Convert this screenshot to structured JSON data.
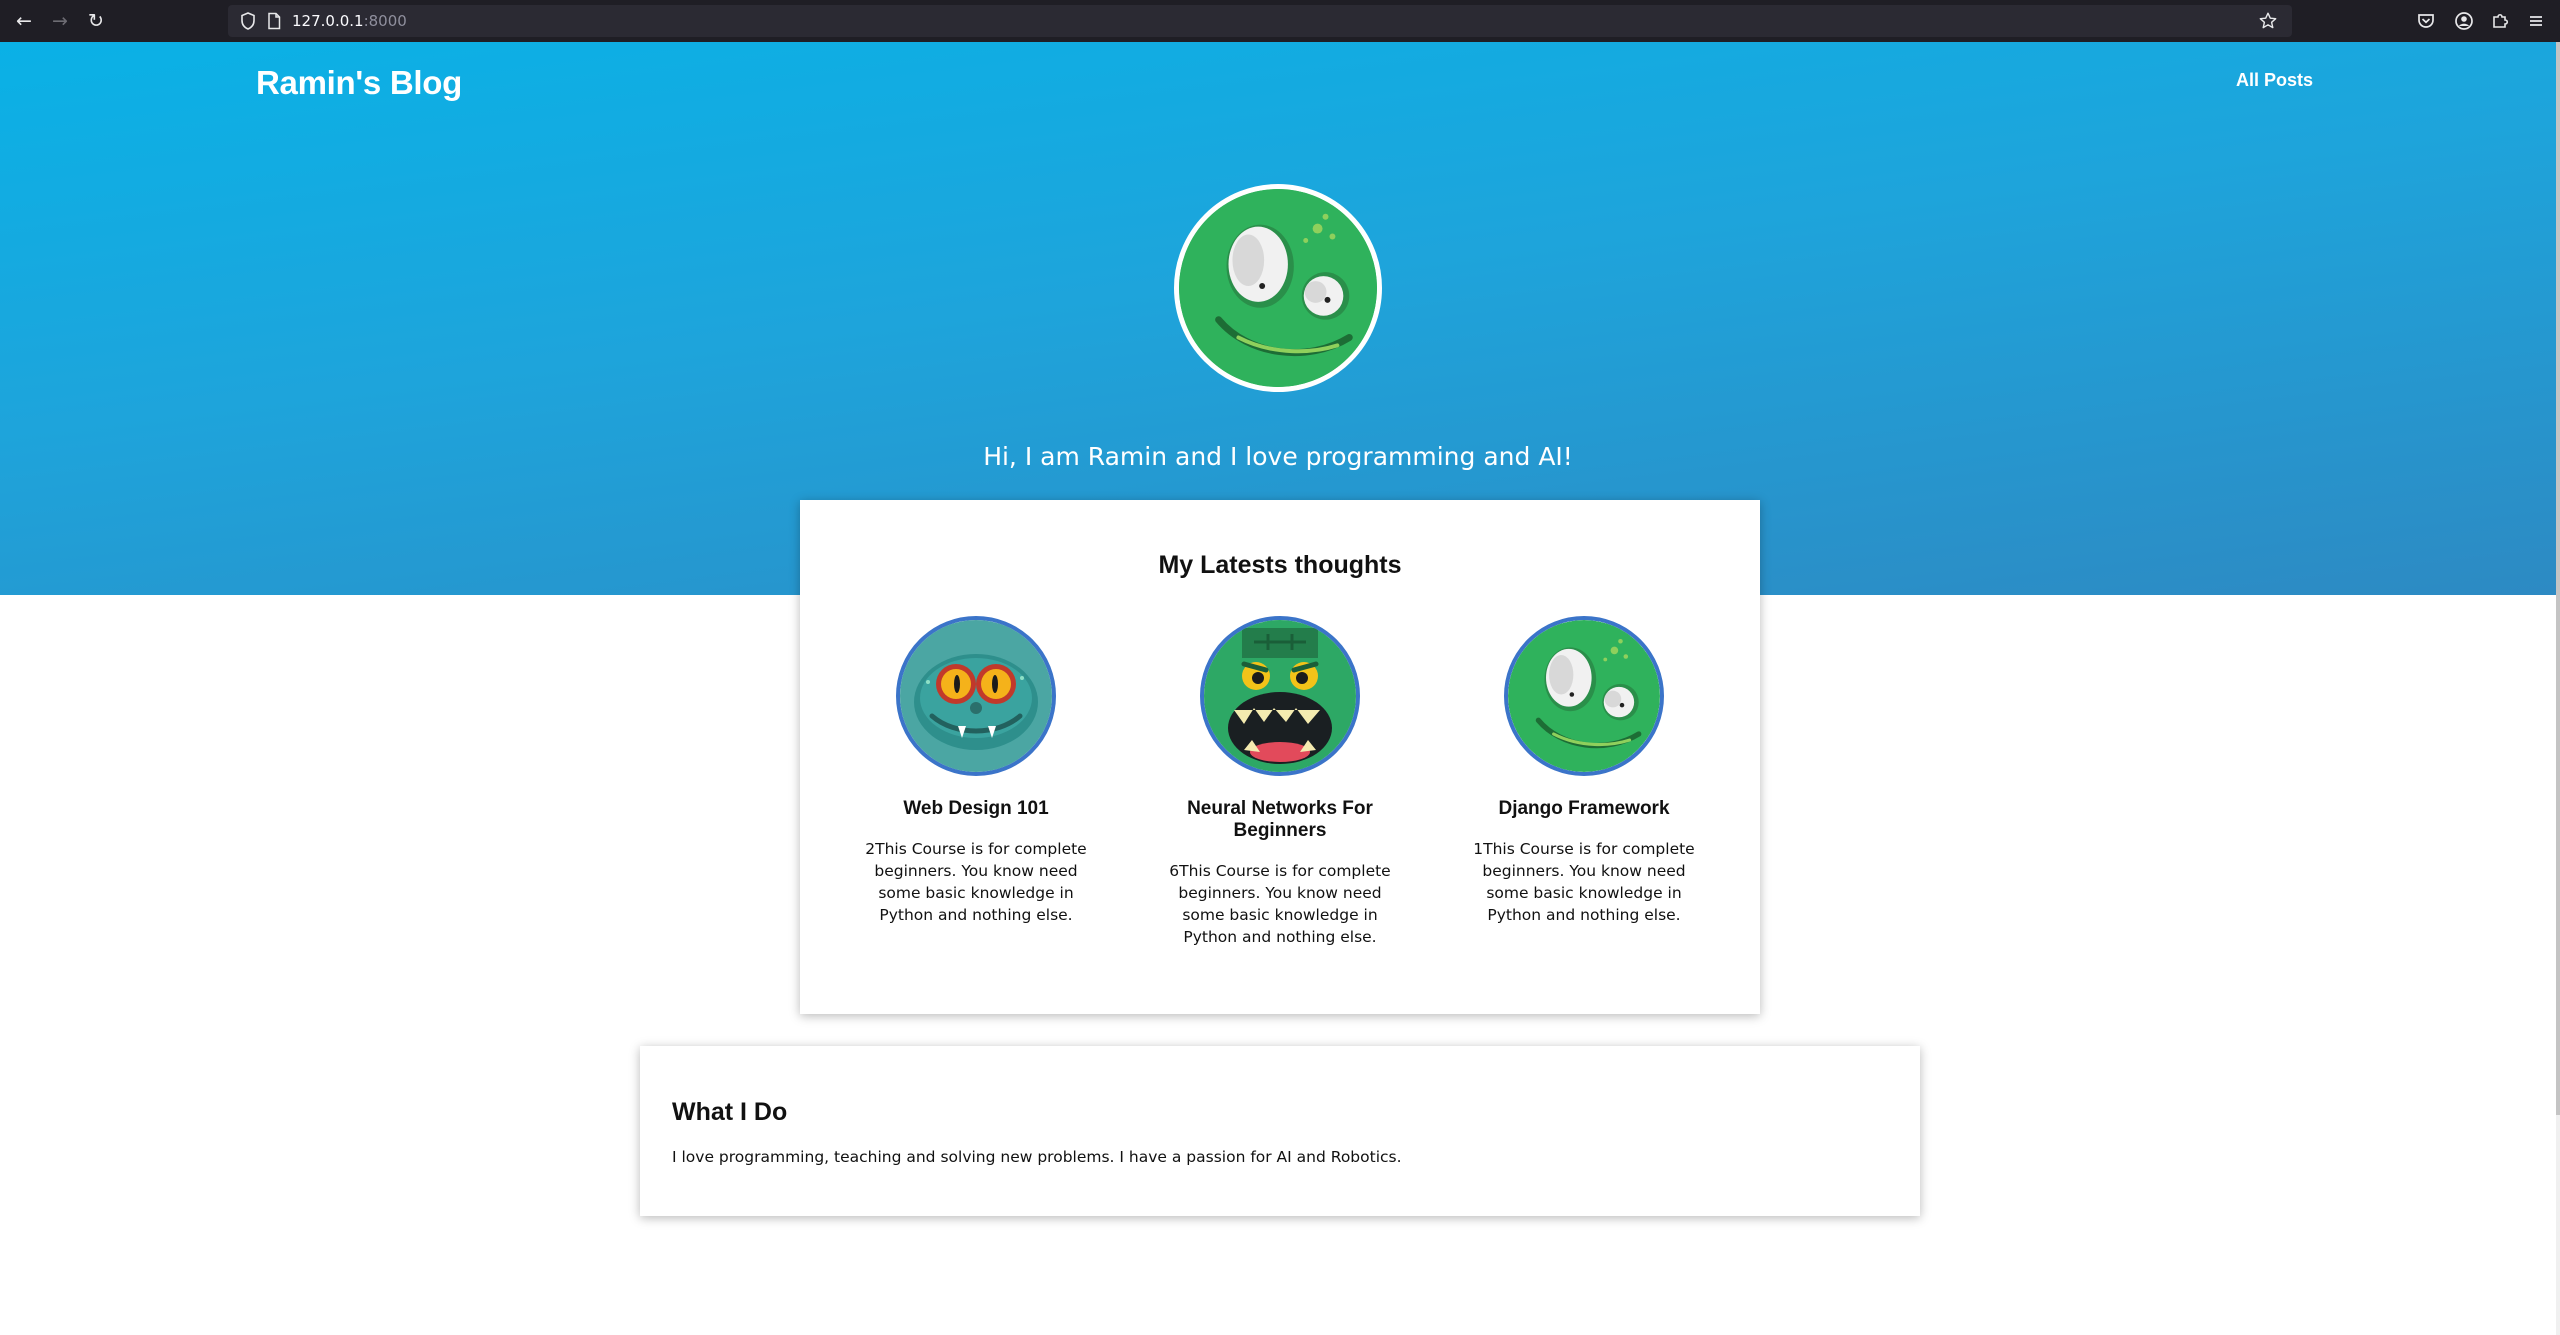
{
  "browser": {
    "url_host": "127.0.0.1",
    "url_port": ":8000",
    "back_icon": "arrow-left-icon",
    "forward_icon": "arrow-right-icon",
    "reload_icon": "reload-icon",
    "bookmark_icon": "star-icon",
    "pocket_icon": "pocket-icon",
    "account_icon": "account-icon",
    "extensions_icon": "puzzle-icon",
    "menu_icon": "hamburger-menu-icon"
  },
  "header": {
    "brand": "Ramin's Blog",
    "nav_all_posts": "All Posts"
  },
  "hero": {
    "tagline": "Hi, I am Ramin and I love programming and AI!",
    "avatar_icon": "green-monster-avatar"
  },
  "latest": {
    "title": "My Latests thoughts",
    "posts": [
      {
        "title": "Web Design 101",
        "excerpt": "2This Course is for complete beginners. You know need some basic knowledge in Python and nothing else.",
        "image": "teal-frog-monster"
      },
      {
        "title": "Neural Networks For Beginners",
        "excerpt": "6This Course is for complete beginners. You know need some basic knowledge in Python and nothing else.",
        "image": "green-zombie-monster"
      },
      {
        "title": "Django Framework",
        "excerpt": "1This Course is for complete beginners. You know need some basic knowledge in Python and nothing else.",
        "image": "green-monster-avatar"
      }
    ]
  },
  "about": {
    "title": "What I Do",
    "text": "I love programming, teaching and solving new problems. I have a passion for AI and Robotics."
  },
  "colors": {
    "hero_top": "#0ab1e6",
    "hero_bottom": "#2d8ac3",
    "avatar_border": "#3b74c9",
    "monster_green": "#2fb25c"
  }
}
